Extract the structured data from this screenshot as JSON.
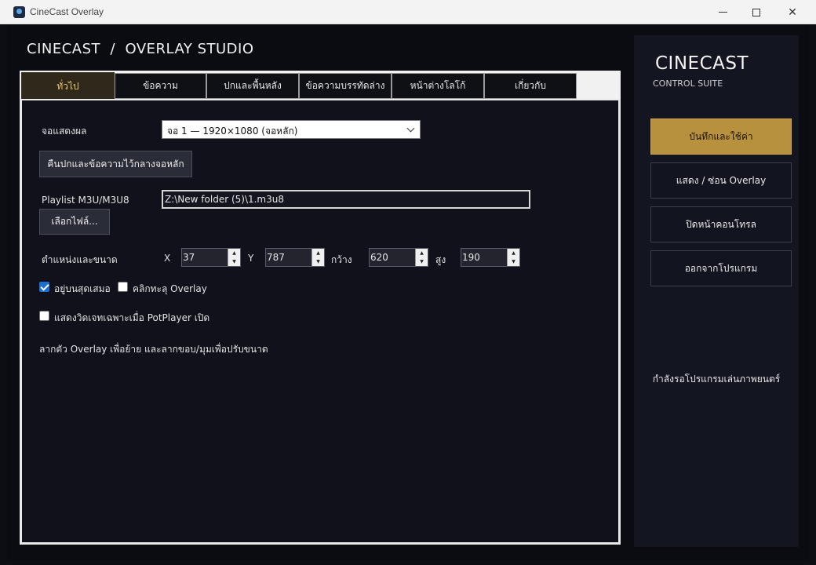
{
  "window": {
    "title": "CineCast Overlay",
    "controls": {
      "minimize": "—",
      "maximize": "☐",
      "close": "✕"
    }
  },
  "header": {
    "title": "CINECAST  /  OVERLAY STUDIO"
  },
  "tabs": [
    {
      "label": "ทั่วไป",
      "active": true
    },
    {
      "label": "ข้อความ"
    },
    {
      "label": "ปกและพื้นหลัง"
    },
    {
      "label": "ข้อความบรรทัดล่าง"
    },
    {
      "label": "หน้าต่างโลโก้"
    },
    {
      "label": "เกี่ยวกับ"
    }
  ],
  "general": {
    "display_label": "จอแสดงผล",
    "display_value": "จอ 1 — 1920×1080 (จอหลัก)",
    "reset_button": "คืนปกและข้อความไว้กลางจอหลัก",
    "playlist_label": "Playlist M3U/M3U8",
    "playlist_path": "Z:\\New folder (5)\\1.m3u8",
    "choose_file_button": "เลือกไฟล์...",
    "position_label": "ตำแหน่งและขนาด",
    "x_label": "X",
    "x_value": "37",
    "y_label": "Y",
    "y_value": "787",
    "width_label": "กว้าง",
    "width_value": "620",
    "height_label": "สูง",
    "height_value": "190",
    "always_on_top_label": "อยู่บนสุดเสมอ",
    "always_on_top": true,
    "click_through_label": "คลิกทะลุ Overlay",
    "click_through": false,
    "potplayer_only_label": "แสดงวิดเจทเฉพาะเมื่อ PotPlayer เปิด",
    "potplayer_only": false,
    "hint": "ลากตัว Overlay เพื่อย้าย และลากขอบ/มุมเพื่อปรับขนาด"
  },
  "sidebar": {
    "brand": "CINECAST",
    "subtitle": "CONTROL SUITE",
    "buttons": [
      {
        "label": "บันทึกและใช้ค่า"
      },
      {
        "label": "แสดง / ซ่อน Overlay"
      },
      {
        "label": "ปิดหน้าคอนโทรล"
      },
      {
        "label": "ออกจากโปรแกรม"
      }
    ],
    "status": "กำลังรอโปรแกรมเล่นภาพยนตร์"
  },
  "colors": {
    "accent": "#b8913e",
    "active_tab_text": "#e8c872",
    "checkbox_checked": "#1b6fd1"
  }
}
